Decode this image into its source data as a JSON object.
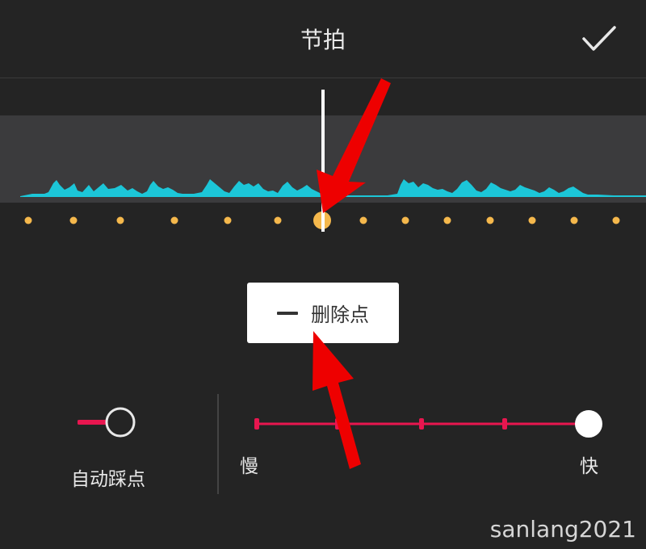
{
  "header": {
    "title": "节拍",
    "confirm_icon": "checkmark-icon"
  },
  "beat_dots": {
    "count": 14,
    "selected_index": 6,
    "dot_color": "#f5b84c"
  },
  "actions": {
    "delete_point_label": "删除点",
    "delete_icon": "minus-icon"
  },
  "auto_beat": {
    "label": "自动踩点",
    "enabled": false
  },
  "speed": {
    "slow_label": "慢",
    "fast_label": "快",
    "steps": 5,
    "selected_step": 4
  },
  "colors": {
    "background": "#242424",
    "waveform": "#1cc6d8",
    "accent": "#e8164f",
    "beat_dot": "#f5b84c",
    "annotation": "#ee0000"
  },
  "watermark": "sanlang2021"
}
